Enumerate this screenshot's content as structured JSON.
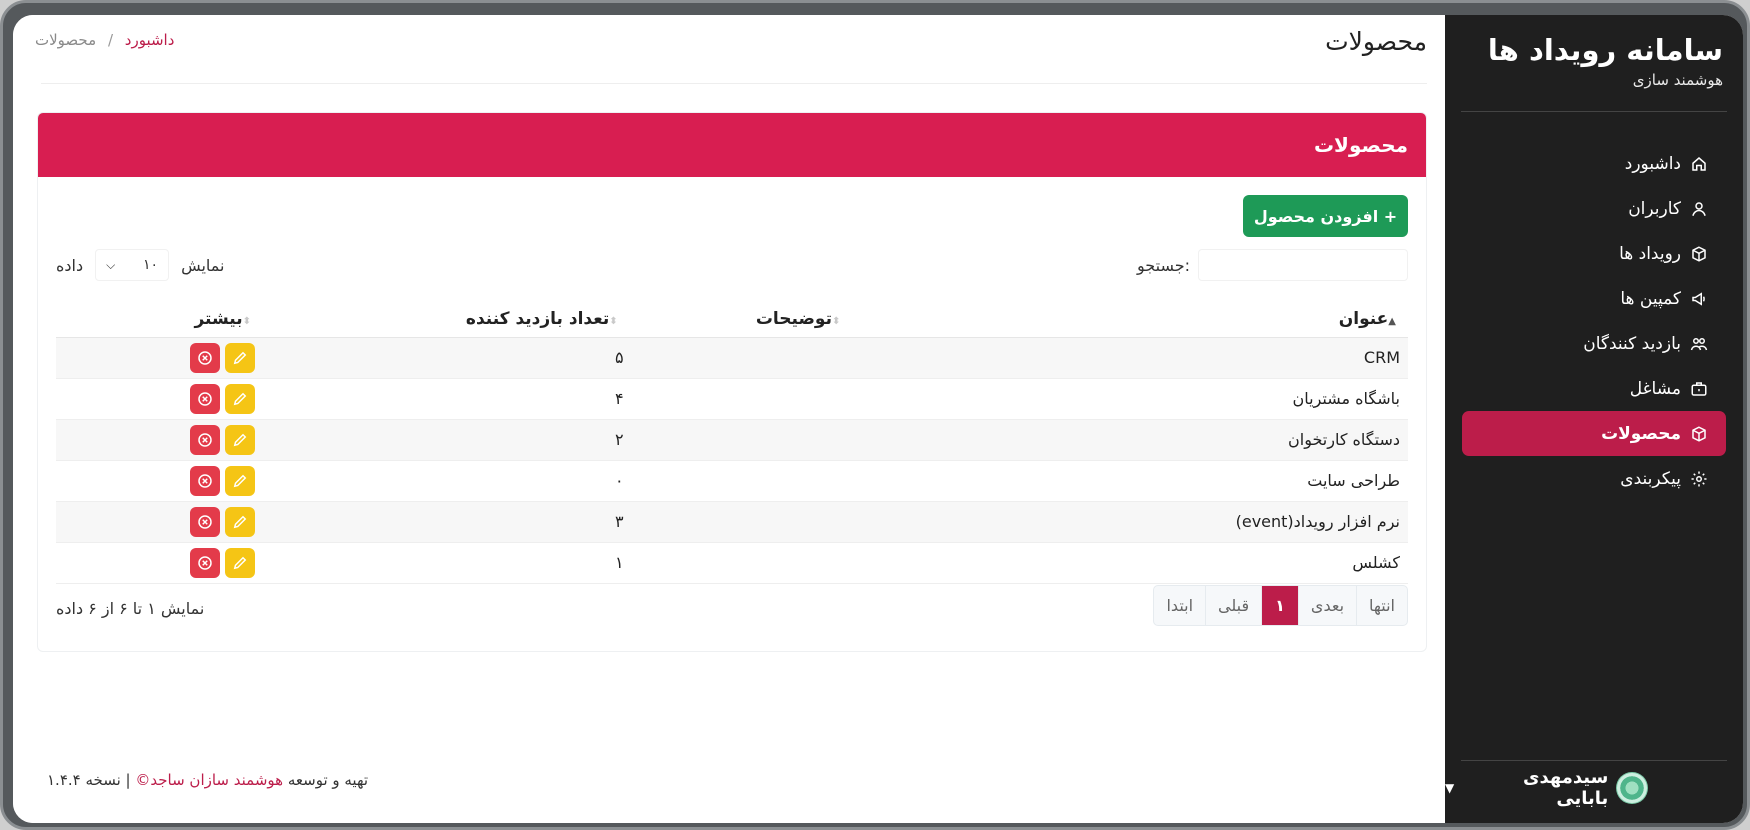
{
  "app": {
    "title": "سامانه رویداد ها",
    "subtitle": "هوشمند سازی"
  },
  "sidebar": {
    "items": [
      {
        "label": "داشبورد",
        "icon": "home-icon",
        "active": false
      },
      {
        "label": "کاربران",
        "icon": "user-icon",
        "active": false
      },
      {
        "label": "رویداد ها",
        "icon": "box-icon",
        "active": false
      },
      {
        "label": "کمپین ها",
        "icon": "megaphone-icon",
        "active": false
      },
      {
        "label": "بازدید کنندگان",
        "icon": "users-icon",
        "active": false
      },
      {
        "label": "مشاغل",
        "icon": "briefcase-icon",
        "active": false
      },
      {
        "label": "محصولات",
        "icon": "box-icon",
        "active": true
      },
      {
        "label": "پیکربندی",
        "icon": "gear-icon",
        "active": false
      }
    ],
    "user_name": "سیدمهدی بابایی"
  },
  "header": {
    "page_title": "محصولات",
    "breadcrumb": {
      "current": "محصولات",
      "separator": "/",
      "link": "داشبورد"
    }
  },
  "card": {
    "title": "محصولات",
    "add_button": "+ افزودن محصول",
    "search_label": ":جستجو",
    "search_value": "",
    "length_prefix": "نمایش",
    "length_value": "۱۰",
    "length_suffix": "داده",
    "columns": [
      "عنوان",
      "توضیحات",
      "تعداد بازدید کننده",
      "بیشتر"
    ],
    "rows": [
      {
        "title": "CRM",
        "desc": "",
        "count": "۵"
      },
      {
        "title": "باشگاه مشتریان",
        "desc": "",
        "count": "۴"
      },
      {
        "title": "دستگاه کارتخوان",
        "desc": "",
        "count": "۲"
      },
      {
        "title": "طراحی سایت",
        "desc": "",
        "count": "۰"
      },
      {
        "title": "نرم افزار رویداد(event)",
        "desc": "",
        "count": "۳"
      },
      {
        "title": "کشلس",
        "desc": "",
        "count": "۱"
      }
    ],
    "info": "نمایش ۱ تا ۶ از ۶ داده",
    "pager": {
      "last": "انتها",
      "next": "بعدی",
      "current": "۱",
      "prev": "قبلی",
      "first": "ابتدا"
    }
  },
  "footer": {
    "prefix": "تهیه و توسعه",
    "company": "هوشمند سازان ساجد©",
    "version": "| نسخه ۱.۴.۴"
  },
  "colors": {
    "accent": "#bc1d4a",
    "card_header": "#d81e51",
    "add_button": "#1e9a57",
    "delete": "#e33b4a",
    "edit": "#f5c515",
    "sidebar_bg": "#1f1f1f"
  }
}
